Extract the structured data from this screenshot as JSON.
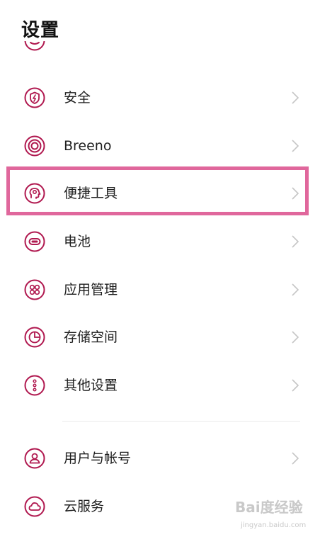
{
  "header": {
    "title": "设置"
  },
  "accent_color": "#b0184f",
  "highlight_color": "#e0679c",
  "items": [
    {
      "label": "安全",
      "icon": "shield-icon"
    },
    {
      "label": "Breeno",
      "icon": "breeno-icon"
    },
    {
      "label": "便捷工具",
      "icon": "tools-icon"
    },
    {
      "label": "电池",
      "icon": "battery-icon"
    },
    {
      "label": "应用管理",
      "icon": "apps-icon"
    },
    {
      "label": "存储空间",
      "icon": "storage-icon"
    },
    {
      "label": "其他设置",
      "icon": "more-icon"
    },
    {
      "label": "用户与帐号",
      "icon": "user-icon"
    },
    {
      "label": "云服务",
      "icon": "cloud-icon"
    }
  ],
  "watermark": {
    "text": "Bai度经验",
    "sub": "jingyan.baidu.com"
  }
}
